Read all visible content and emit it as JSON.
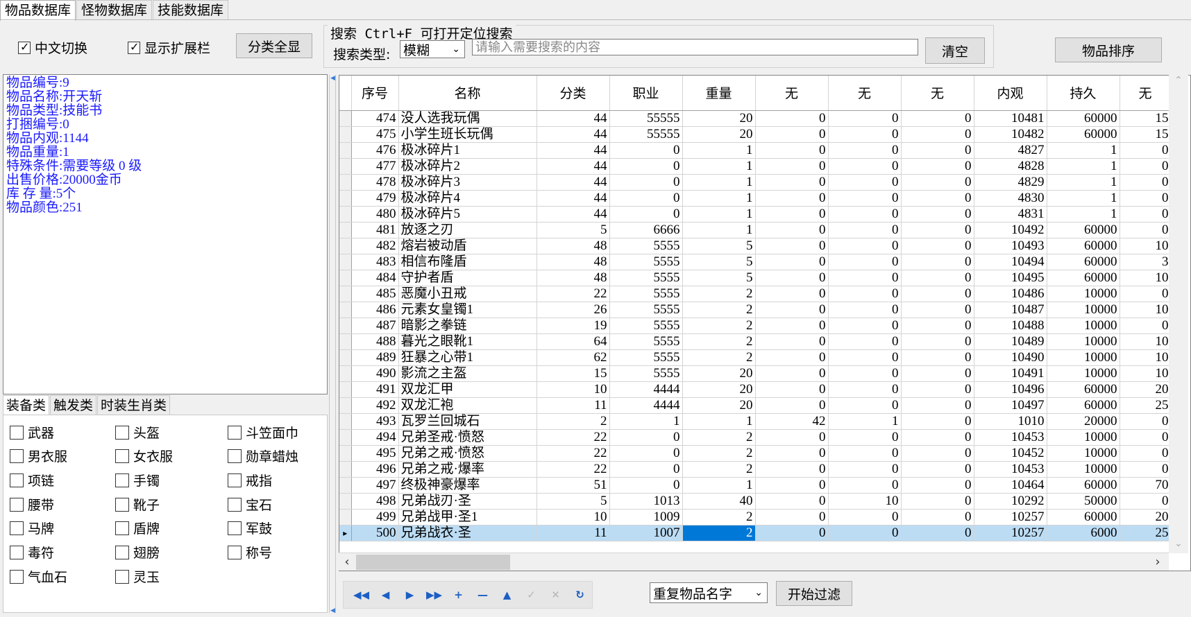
{
  "top_tabs": [
    "物品数据库",
    "怪物数据库",
    "技能数据库"
  ],
  "toolbar": {
    "cn_toggle": "中文切换",
    "show_ext": "显示扩展栏",
    "show_all_btn": "分类全显",
    "search_title": "搜索  Ctrl+F 可打开定位搜索",
    "search_type_label": "搜索类型:",
    "search_type_value": "模糊",
    "search_placeholder": "请输入需要搜索的内容",
    "clear_btn": "清空",
    "sort_btn": "物品排序"
  },
  "info": [
    "物品编号:9",
    "物品名称:开天斩",
    "物品类型:技能书",
    "打捆编号:0",
    "物品内观:1144",
    "物品重量:1",
    "特殊条件:需要等级 0 级",
    "出售价格:20000金币",
    "库 存 量:5个",
    "物品颜色:251"
  ],
  "category_tabs": [
    "装备类",
    "触发类",
    "时装生肖类"
  ],
  "categories": [
    "武器",
    "头盔",
    "斗笠面巾",
    "男衣服",
    "女衣服",
    "勋章蜡烛",
    "项链",
    "手镯",
    "戒指",
    "腰带",
    "靴子",
    "宝石",
    "马牌",
    "盾牌",
    "军鼓",
    "毒符",
    "翅膀",
    "称号",
    "气血石",
    "灵玉"
  ],
  "grid": {
    "columns": [
      "序号",
      "名称",
      "分类",
      "职业",
      "重量",
      "无",
      "无",
      "无",
      "内观",
      "持久",
      "无"
    ],
    "rows": [
      [
        "474",
        "没人选我玩偶",
        "44",
        "55555",
        "20",
        "0",
        "0",
        "0",
        "10481",
        "60000",
        "15"
      ],
      [
        "475",
        "小学生班长玩偶",
        "44",
        "55555",
        "20",
        "0",
        "0",
        "0",
        "10482",
        "60000",
        "15"
      ],
      [
        "476",
        "极冰碎片1",
        "44",
        "0",
        "1",
        "0",
        "0",
        "0",
        "4827",
        "1",
        "0"
      ],
      [
        "477",
        "极冰碎片2",
        "44",
        "0",
        "1",
        "0",
        "0",
        "0",
        "4828",
        "1",
        "0"
      ],
      [
        "478",
        "极冰碎片3",
        "44",
        "0",
        "1",
        "0",
        "0",
        "0",
        "4829",
        "1",
        "0"
      ],
      [
        "479",
        "极冰碎片4",
        "44",
        "0",
        "1",
        "0",
        "0",
        "0",
        "4830",
        "1",
        "0"
      ],
      [
        "480",
        "极冰碎片5",
        "44",
        "0",
        "1",
        "0",
        "0",
        "0",
        "4831",
        "1",
        "0"
      ],
      [
        "481",
        "放逐之刃",
        "5",
        "6666",
        "1",
        "0",
        "0",
        "0",
        "10492",
        "60000",
        "0"
      ],
      [
        "482",
        "熔岩被动盾",
        "48",
        "5555",
        "5",
        "0",
        "0",
        "0",
        "10493",
        "60000",
        "10"
      ],
      [
        "483",
        "相信布隆盾",
        "48",
        "5555",
        "5",
        "0",
        "0",
        "0",
        "10494",
        "60000",
        "3"
      ],
      [
        "484",
        "守护者盾",
        "48",
        "5555",
        "5",
        "0",
        "0",
        "0",
        "10495",
        "60000",
        "10"
      ],
      [
        "485",
        "恶魔小丑戒",
        "22",
        "5555",
        "2",
        "0",
        "0",
        "0",
        "10486",
        "10000",
        "0"
      ],
      [
        "486",
        "元素女皇镯1",
        "26",
        "5555",
        "2",
        "0",
        "0",
        "0",
        "10487",
        "10000",
        "10"
      ],
      [
        "487",
        "暗影之拳链",
        "19",
        "5555",
        "2",
        "0",
        "0",
        "0",
        "10488",
        "10000",
        "0"
      ],
      [
        "488",
        "暮光之眼靴1",
        "64",
        "5555",
        "2",
        "0",
        "0",
        "0",
        "10489",
        "10000",
        "10"
      ],
      [
        "489",
        "狂暴之心带1",
        "62",
        "5555",
        "2",
        "0",
        "0",
        "0",
        "10490",
        "10000",
        "10"
      ],
      [
        "490",
        "影流之主盔",
        "15",
        "5555",
        "20",
        "0",
        "0",
        "0",
        "10491",
        "10000",
        "10"
      ],
      [
        "491",
        "双龙汇甲",
        "10",
        "4444",
        "20",
        "0",
        "0",
        "0",
        "10496",
        "60000",
        "20"
      ],
      [
        "492",
        "双龙汇袍",
        "11",
        "4444",
        "20",
        "0",
        "0",
        "0",
        "10497",
        "60000",
        "25"
      ],
      [
        "493",
        "瓦罗兰回城石",
        "2",
        "1",
        "1",
        "42",
        "1",
        "0",
        "1010",
        "20000",
        "0"
      ],
      [
        "494",
        "兄弟圣戒·愤怒",
        "22",
        "0",
        "2",
        "0",
        "0",
        "0",
        "10453",
        "10000",
        "0"
      ],
      [
        "495",
        "兄弟之戒·愤怒",
        "22",
        "0",
        "2",
        "0",
        "0",
        "0",
        "10452",
        "10000",
        "0"
      ],
      [
        "496",
        "兄弟之戒·爆率",
        "22",
        "0",
        "2",
        "0",
        "0",
        "0",
        "10453",
        "10000",
        "0"
      ],
      [
        "497",
        "终极神豪爆率",
        "51",
        "0",
        "1",
        "0",
        "0",
        "0",
        "10464",
        "60000",
        "70"
      ],
      [
        "498",
        "兄弟战刃·圣",
        "5",
        "1013",
        "40",
        "0",
        "10",
        "0",
        "10292",
        "50000",
        "0"
      ],
      [
        "499",
        "兄弟战甲·圣1",
        "10",
        "1009",
        "2",
        "0",
        "0",
        "0",
        "10257",
        "60000",
        "20"
      ],
      [
        "500",
        "兄弟战衣·圣",
        "11",
        "1007",
        "2",
        "0",
        "0",
        "0",
        "10257",
        "6000",
        "25"
      ]
    ],
    "selected_row": 26,
    "selected_col": 4,
    "current_row_marker": "▸"
  },
  "bottom": {
    "filter_select": "重复物品名字",
    "filter_btn": "开始过滤"
  },
  "nav_icons": [
    "first-icon",
    "prev-icon",
    "next-icon",
    "last-icon",
    "insert-icon",
    "delete-icon",
    "edit-icon",
    "post-icon",
    "cancel-icon",
    "refresh-icon"
  ]
}
